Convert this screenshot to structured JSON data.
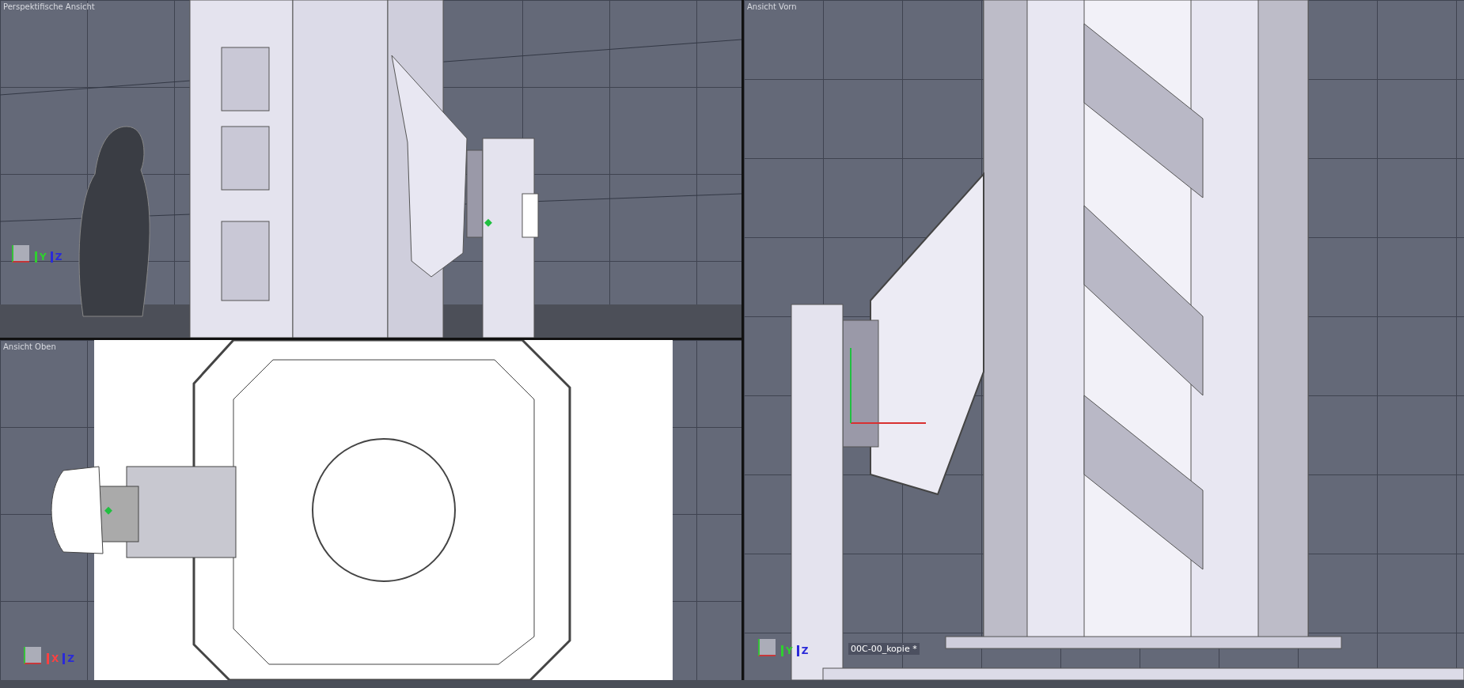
{
  "viewports": [
    {
      "kind": "perspective",
      "label": "Perspektifische Ansicht",
      "axes": [
        {
          "letter": "Y",
          "color": "#2fd02f"
        },
        {
          "letter": "Z",
          "color": "#2a2ad8"
        }
      ]
    },
    {
      "kind": "top",
      "label": "Ansicht Oben",
      "axes": [
        {
          "letter": "X",
          "color": "#ff4040"
        },
        {
          "letter": "Z",
          "color": "#2a2ad8"
        }
      ]
    },
    {
      "kind": "front",
      "label": "Ansicht Vorn",
      "axes": [
        {
          "letter": "Y",
          "color": "#2fd02f"
        },
        {
          "letter": "Z",
          "color": "#2a2ad8"
        }
      ],
      "object_label": "00C-00_kopie *"
    }
  ]
}
